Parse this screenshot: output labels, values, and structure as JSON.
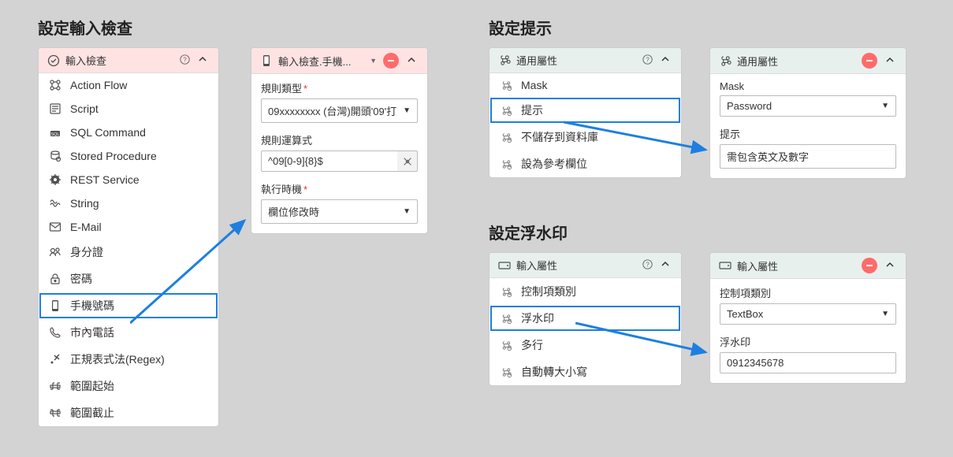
{
  "sections": {
    "input_check": "設定輸入檢查",
    "hint": "設定提示",
    "watermark": "設定浮水印"
  },
  "input_check_panel": {
    "title": "輸入檢查",
    "items": [
      "Action Flow",
      "Script",
      "SQL Command",
      "Stored Procedure",
      "REST Service",
      "String",
      "E-Mail",
      "身分證",
      "密碼",
      "手機號碼",
      "市內電話",
      "正規表式法(Regex)",
      "範圍起始",
      "範圍截止"
    ],
    "highlighted_index": 9
  },
  "rule_panel": {
    "title": "輸入檢查.手機...",
    "rule_type_label": "規則類型",
    "rule_type_value": "09xxxxxxxx (台灣)開頭'09'打",
    "rule_expr_label": "規則運算式",
    "rule_expr_value": "^09[0-9]{8}$",
    "exec_timing_label": "執行時機",
    "exec_timing_value": "欄位修改時"
  },
  "common_props_left": {
    "title": "通用屬性",
    "items": [
      "Mask",
      "提示",
      "不儲存到資料庫",
      "設為參考欄位"
    ],
    "highlighted_index": 1
  },
  "common_props_right": {
    "title": "通用屬性",
    "mask_label": "Mask",
    "mask_value": "Password",
    "hint_label": "提示",
    "hint_value": "需包含英文及數字"
  },
  "input_props_left": {
    "title": "輸入屬性",
    "items": [
      "控制項類別",
      "浮水印",
      "多行",
      "自動轉大小寫"
    ],
    "highlighted_index": 1
  },
  "input_props_right": {
    "title": "輸入屬性",
    "control_label": "控制項類別",
    "control_value": "TextBox",
    "watermark_label": "浮水印",
    "watermark_value": "0912345678"
  },
  "icons": {
    "check_circle": "check",
    "help": "?",
    "caret": "^"
  }
}
